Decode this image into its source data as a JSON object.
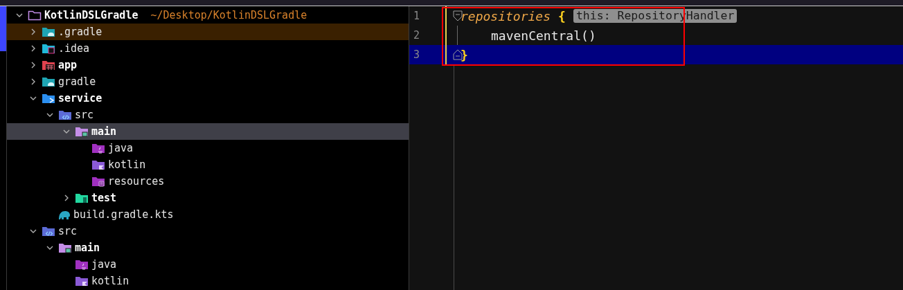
{
  "project_tree": {
    "items": [
      {
        "label": "KotlinDSLGradle",
        "path": "~/Desktop/KotlinDSLGradle",
        "kind": "project",
        "bold": true,
        "expanded": true,
        "selected": false,
        "highlighted": false,
        "children": [
          {
            "label": ".gradle",
            "kind": "gradle-folder",
            "bold": false,
            "expanded": false,
            "selected": false,
            "highlighted": true
          },
          {
            "label": ".idea",
            "kind": "idea-folder",
            "bold": false,
            "expanded": false,
            "selected": false,
            "highlighted": false
          },
          {
            "label": "app",
            "kind": "app-module",
            "bold": true,
            "expanded": false,
            "selected": false,
            "highlighted": false
          },
          {
            "label": "gradle",
            "kind": "gradle-folder",
            "bold": false,
            "expanded": false,
            "selected": false,
            "highlighted": false
          },
          {
            "label": "service",
            "kind": "module",
            "bold": true,
            "expanded": true,
            "selected": false,
            "highlighted": false,
            "children": [
              {
                "label": "src",
                "kind": "source",
                "bold": false,
                "expanded": true,
                "selected": false,
                "highlighted": false,
                "children": [
                  {
                    "label": "main",
                    "kind": "main",
                    "bold": true,
                    "expanded": true,
                    "selected": true,
                    "highlighted": false,
                    "children": [
                      {
                        "label": "java",
                        "kind": "java",
                        "bold": false,
                        "selected": false
                      },
                      {
                        "label": "kotlin",
                        "kind": "kotlin",
                        "bold": false,
                        "selected": false
                      },
                      {
                        "label": "resources",
                        "kind": "resources",
                        "bold": false,
                        "selected": false
                      }
                    ]
                  },
                  {
                    "label": "test",
                    "kind": "test",
                    "bold": true,
                    "expanded": false,
                    "selected": false,
                    "highlighted": false
                  }
                ]
              },
              {
                "label": "build.gradle.kts",
                "kind": "gradle-file",
                "bold": false,
                "selected": false,
                "highlighted": false
              }
            ]
          },
          {
            "label": "src",
            "kind": "source",
            "bold": false,
            "expanded": true,
            "selected": false,
            "highlighted": false,
            "children": [
              {
                "label": "main",
                "kind": "main",
                "bold": true,
                "expanded": true,
                "selected": false,
                "highlighted": false,
                "children": [
                  {
                    "label": "java",
                    "kind": "java",
                    "bold": false,
                    "selected": false,
                    "highlighted": false
                  },
                  {
                    "label": "kotlin",
                    "kind": "kotlin",
                    "bold": false,
                    "selected": false,
                    "highlighted": false
                  }
                ]
              }
            ]
          }
        ]
      }
    ]
  },
  "editor": {
    "lines": [
      {
        "number": "1",
        "current": false,
        "fold_start": true,
        "fold_end": false,
        "tokens": [
          {
            "kind": "function",
            "text": "repositories"
          },
          {
            "kind": "brace",
            "text": "{"
          },
          {
            "kind": "hint",
            "text": "this: RepositoryHandler"
          }
        ]
      },
      {
        "number": "2",
        "current": false,
        "fold_start": false,
        "fold_end": false,
        "tokens": [
          {
            "kind": "plain",
            "text": "mavenCentral()"
          }
        ]
      },
      {
        "number": "3",
        "current": true,
        "fold_start": false,
        "fold_end": true,
        "tokens": [
          {
            "kind": "brace",
            "text": "}"
          }
        ]
      }
    ],
    "annotation_box": true
  }
}
